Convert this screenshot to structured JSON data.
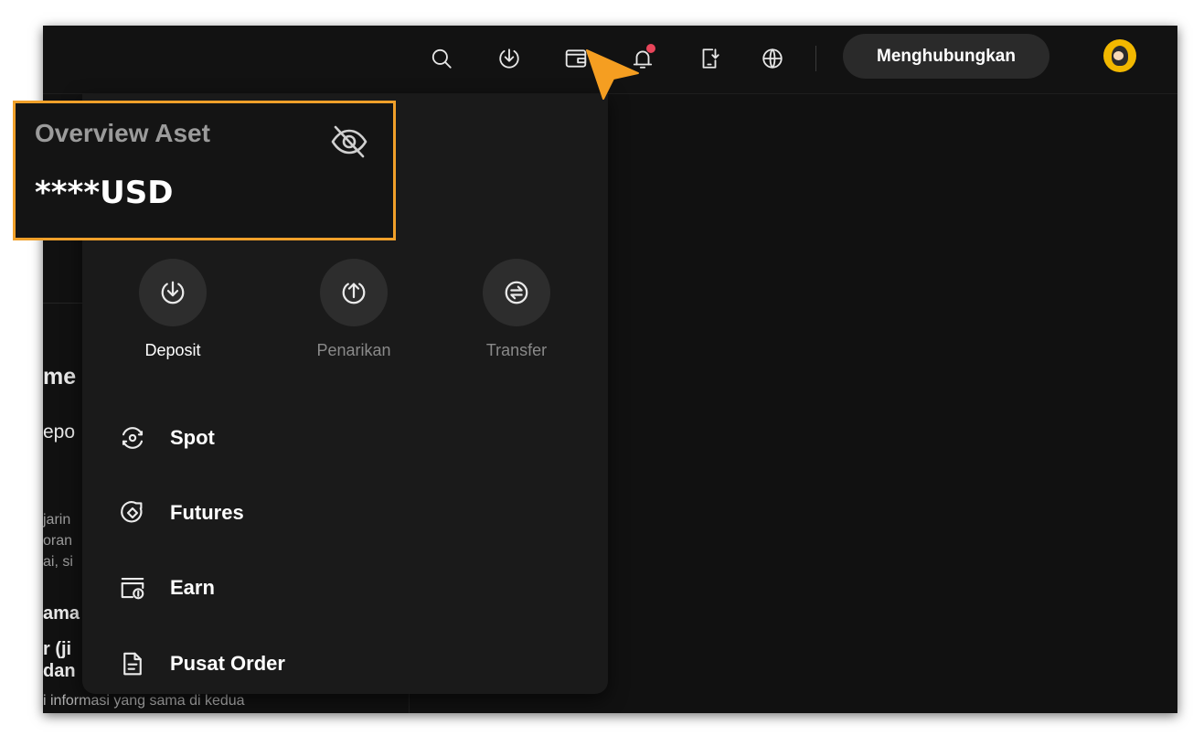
{
  "topbar": {
    "icons": [
      "search-icon",
      "download-icon",
      "wallet-icon",
      "bell-icon",
      "mobile-download-icon",
      "globe-icon"
    ],
    "connect_label": "Menghubungkan",
    "notification_dot_color": "#e8455a"
  },
  "overview": {
    "title": "Overview Aset",
    "value": "****USD",
    "highlight_color": "#f0a02a"
  },
  "actions": [
    {
      "label": "Deposit"
    },
    {
      "label": "Penarikan"
    },
    {
      "label": "Transfer"
    }
  ],
  "menu": [
    {
      "label": "Spot"
    },
    {
      "label": "Futures"
    },
    {
      "label": "Earn"
    },
    {
      "label": "Pusat Order"
    }
  ],
  "background_page": {
    "heading_fragment": "me",
    "line1_fragment": "epo",
    "small_lines": [
      "jarin",
      "oran",
      "ai, si"
    ],
    "bold_lines": [
      "ama",
      "r (ji",
      "dan"
    ],
    "bottom_line": "i informasi yang sama di kedua"
  }
}
